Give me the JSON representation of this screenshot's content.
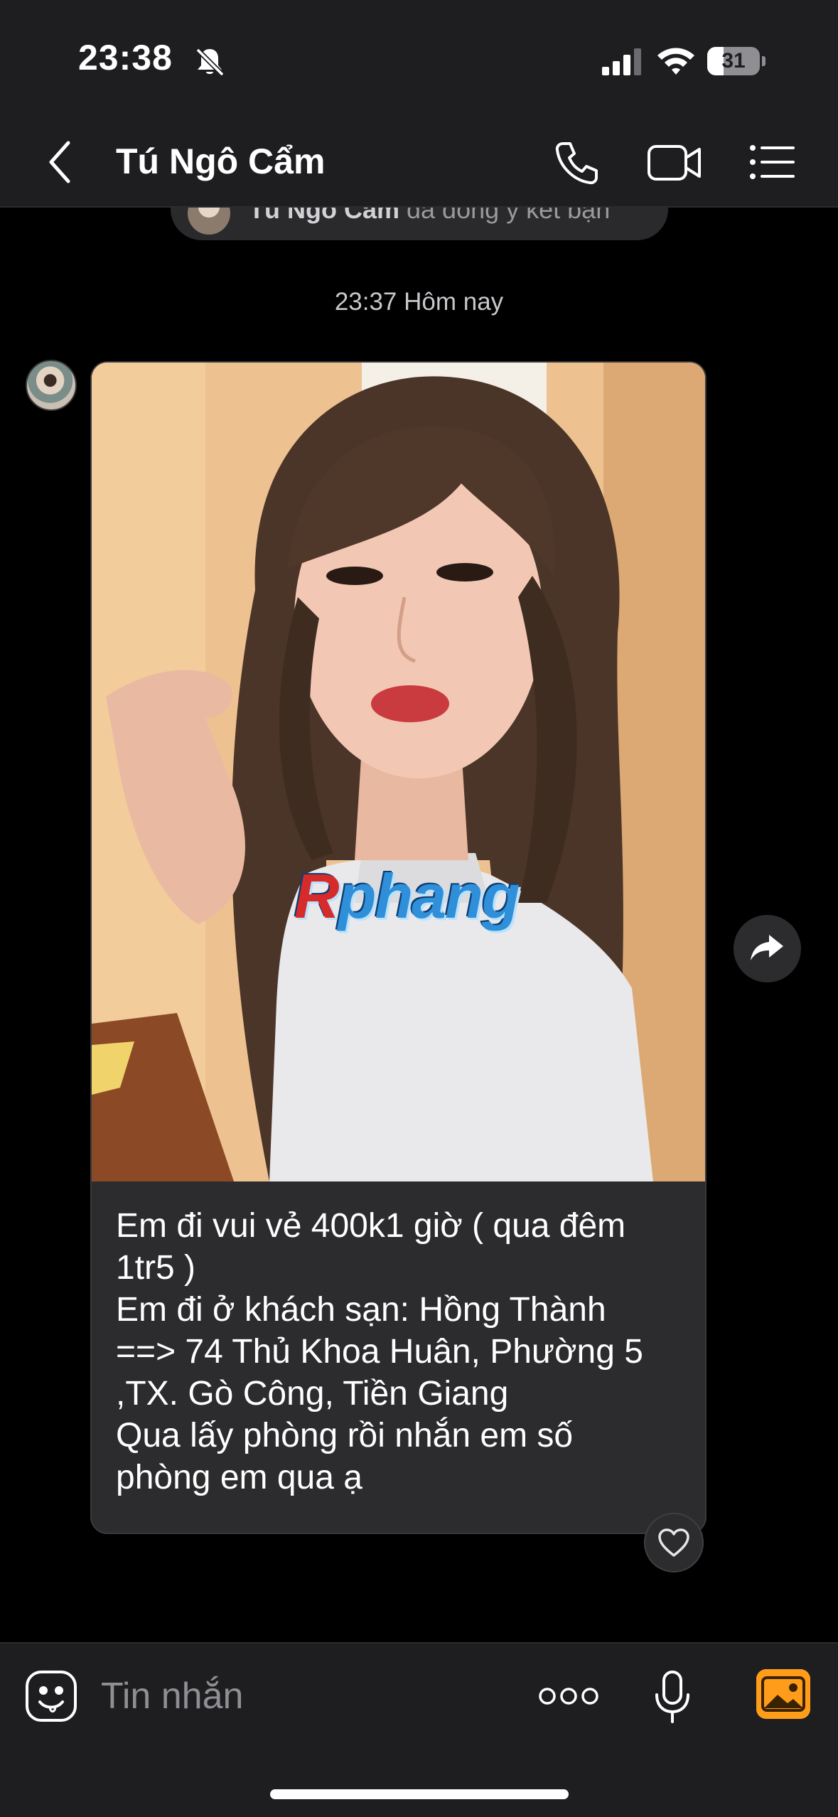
{
  "status_bar": {
    "time": "23:38",
    "battery": "31",
    "battery_level": 0.31,
    "icons": [
      "bell-slash-icon",
      "cellular-signal-icon",
      "wifi-icon",
      "battery-icon"
    ]
  },
  "header": {
    "title": "Tú Ngô Cẩm",
    "icons": [
      "back-chevron-icon",
      "phone-call-icon",
      "video-call-icon",
      "list-menu-icon"
    ]
  },
  "system_notice": {
    "name": "Tú Ngô Cẩm",
    "text": " đã đồng ý kết bạn"
  },
  "timestamp": "23:37 Hôm nay",
  "message": {
    "image_watermark": {
      "first": "R",
      "rest": "phang"
    },
    "lines": [
      "Em đi vui vẻ 400k1 giờ ( qua đêm",
      "1tr5 )",
      "Em đi ở khách sạn: Hồng Thành",
      "==> 74 Thủ Khoa Huân, Phường 5",
      ",TX. Gò Công, Tiền Giang",
      "Qua lấy phòng rồi nhắn em số",
      "phòng em qua ạ"
    ],
    "icons": [
      "heart-icon",
      "share-arrow-icon"
    ]
  },
  "input_bar": {
    "placeholder": "Tin nhắn",
    "icons": [
      "sticker-icon",
      "more-dots-icon",
      "microphone-icon",
      "gallery-icon"
    ]
  },
  "colors": {
    "background": "#000000",
    "bar": "#1e1e20",
    "bubble": "#2c2c2e",
    "gallery_accent": "#ff9d1a"
  }
}
